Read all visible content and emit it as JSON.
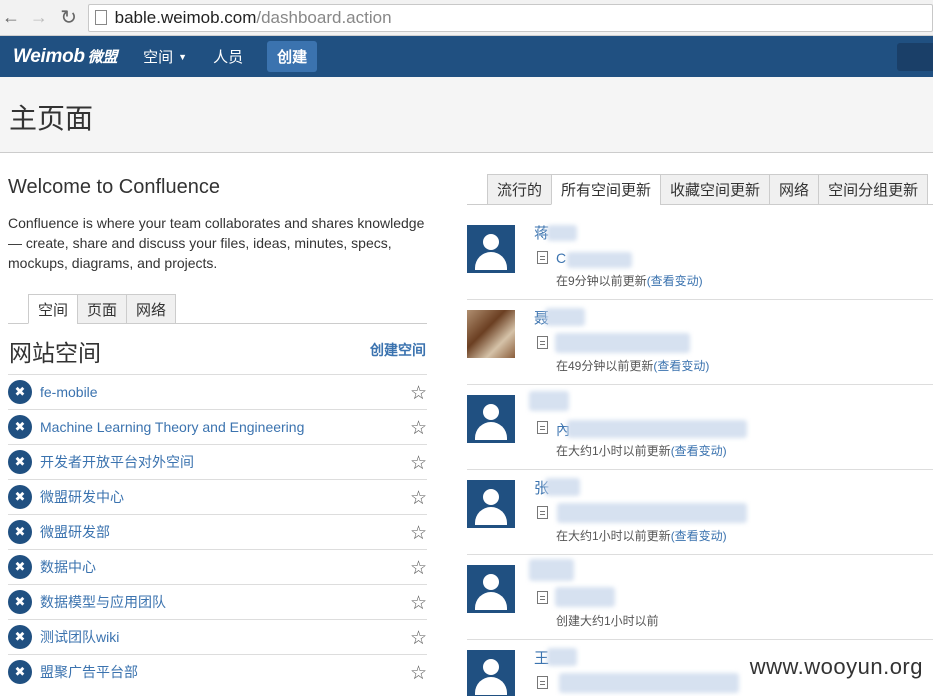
{
  "browser": {
    "url_host": "bable.weimob.com",
    "url_path": "/dashboard.action"
  },
  "topnav": {
    "logo": "Weimob",
    "logo_cn": "微盟",
    "spaces_label": "空间",
    "people_label": "人员",
    "create_label": "创建"
  },
  "page": {
    "title": "主页面"
  },
  "welcome": {
    "title": "Welcome to Confluence",
    "text": "Confluence is where your team collaborates and shares knowledge — create, share and discuss your files, ideas, minutes, specs, mockups, diagrams, and projects."
  },
  "left_tabs": [
    "空间",
    "页面",
    "网络"
  ],
  "spaces": {
    "heading": "网站空间",
    "create_link": "创建空间",
    "items": [
      "fe-mobile",
      "Machine Learning Theory and Engineering",
      "开发者开放平台对外空间",
      "微盟研发中心",
      "微盟研发部",
      "数据中心",
      "数据模型与应用团队",
      "测试团队wiki",
      "盟聚广告平台部"
    ]
  },
  "right_tabs": [
    "流行的",
    "所有空间更新",
    "收藏空间更新",
    "网络",
    "空间分组更新"
  ],
  "feed": [
    {
      "user": "蒋",
      "title": "C",
      "time": "在9分钟以前更新",
      "link": "(查看变动)"
    },
    {
      "user": "聂",
      "title": "",
      "time": "在49分钟以前更新",
      "link": "(查看变动)"
    },
    {
      "user": "",
      "title": "內",
      "time": "在大约1小时以前更新",
      "link": "(查看变动)"
    },
    {
      "user": "张",
      "title": "",
      "time": "在大约1小时以前更新",
      "link": "(查看变动)"
    },
    {
      "user": "",
      "title": "",
      "time": "创建大约1小时以前",
      "link": ""
    },
    {
      "user": "王",
      "title": "",
      "time": "",
      "link": ""
    }
  ],
  "watermark": "www.wooyun.org"
}
